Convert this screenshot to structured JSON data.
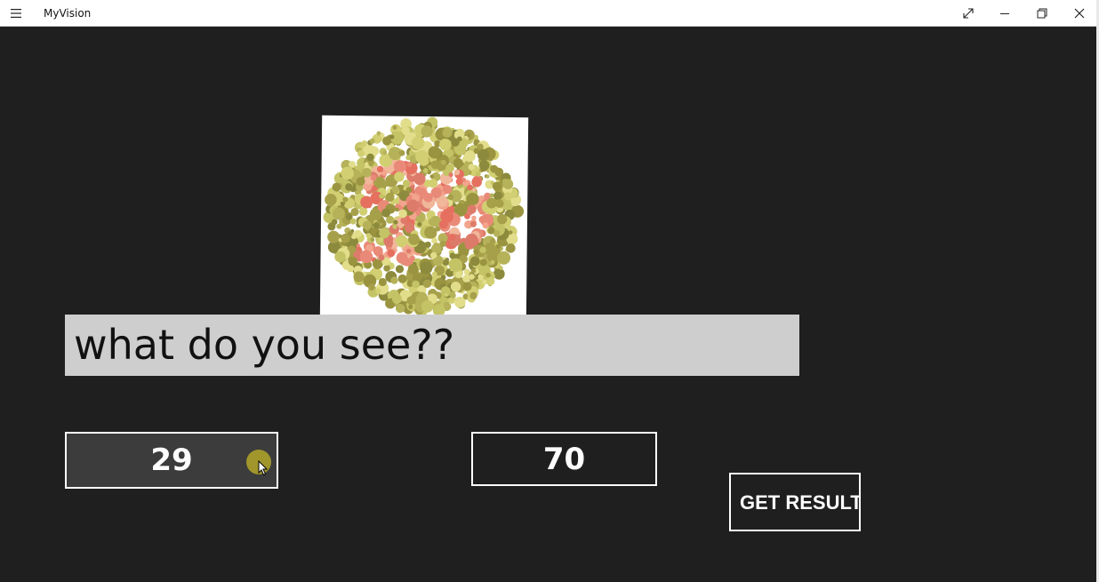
{
  "window": {
    "title": "MyVision",
    "menu_icon": "hamburger-icon",
    "caption_icons": [
      "expand-icon",
      "minimize-icon",
      "restore-icon",
      "close-icon"
    ]
  },
  "test": {
    "plate_image": "ishihara-color-plate",
    "question": "what do you see??",
    "options": [
      {
        "label": "29",
        "state": "hovered"
      },
      {
        "label": "70",
        "state": "normal"
      }
    ],
    "result_button": "GET RESULT"
  },
  "colors": {
    "background": "#1f1f1f",
    "question_bar": "#cecece",
    "hover_indicator": "#a59b2a"
  }
}
